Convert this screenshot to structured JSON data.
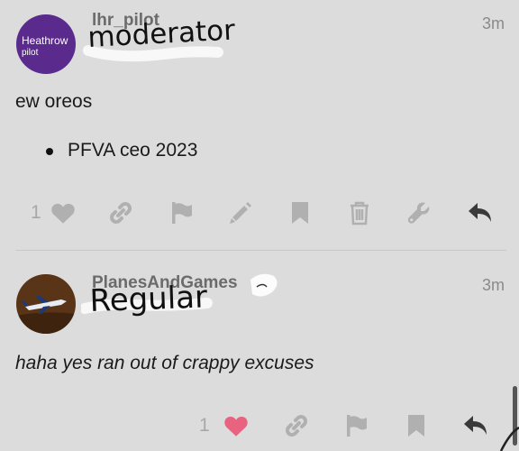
{
  "posts": [
    {
      "username": "lhr_pilot",
      "avatar_text_1": "Heathrow",
      "avatar_text_2": "pilot",
      "avatar_color": "#5a2a8c",
      "handwritten_title": "moderator",
      "time": "3m",
      "body": "ew oreos",
      "list_items": [
        "PFVA ceo 2023"
      ],
      "like_count": "1",
      "liked": false,
      "actions": [
        "heart-icon",
        "link-icon",
        "flag-icon",
        "pencil-icon",
        "bookmark-icon",
        "trash-icon",
        "wrench-icon",
        "reply-icon"
      ]
    },
    {
      "username": "PlanesAndGames",
      "avatar_color": "#5a3416",
      "handwritten_title": "Regular",
      "time": "3m",
      "body": "haha yes ran out of crappy excuses",
      "like_count": "1",
      "liked": true,
      "actions": [
        "heart-icon",
        "link-icon",
        "flag-icon",
        "bookmark-icon",
        "reply-icon"
      ]
    }
  ],
  "colors": {
    "icon_muted": "#b0b0b0",
    "icon_dark": "#3a3a3a",
    "heart_liked": "#e8637f"
  }
}
